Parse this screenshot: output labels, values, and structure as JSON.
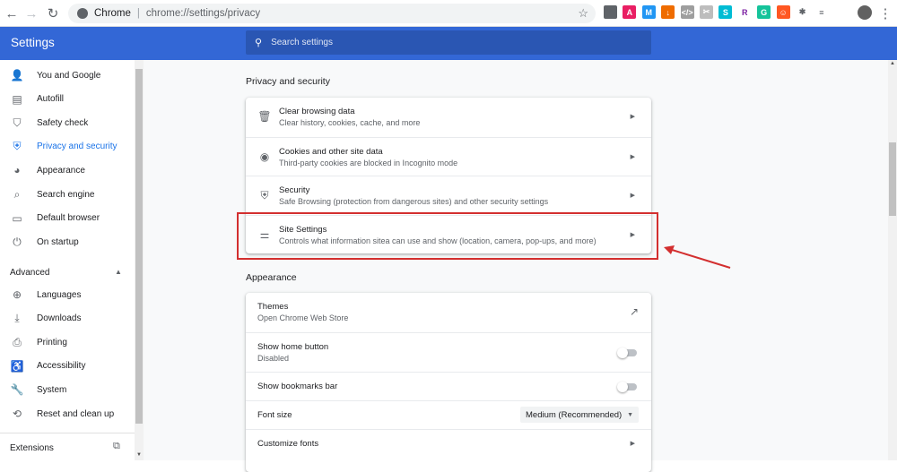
{
  "browser": {
    "back_icon": "←",
    "forward_icon": "→",
    "reload_icon": "↻",
    "chip": "Chrome",
    "url": "chrome://settings/privacy",
    "star_icon": "☆",
    "menu_icon": "⋮"
  },
  "extensions": [
    {
      "name": "eyedropper-icon",
      "glyph": "✎",
      "color": "#5f6368",
      "text": "#5f6368"
    },
    {
      "name": "ext-a-icon",
      "glyph": "A",
      "color": "#e91e63",
      "text": "#fff"
    },
    {
      "name": "ext-m-icon",
      "glyph": "M",
      "color": "#2196f3",
      "text": "#fff"
    },
    {
      "name": "ext-download-icon",
      "glyph": "↓",
      "color": "#ef6c00",
      "text": "#fff"
    },
    {
      "name": "ext-code-icon",
      "glyph": "</>",
      "color": "#9e9e9e",
      "text": "#fff"
    },
    {
      "name": "ext-clip-icon",
      "glyph": "✂",
      "color": "#bdbdbd",
      "text": "#fff"
    },
    {
      "name": "ext-s-icon",
      "glyph": "S",
      "color": "#00bcd4",
      "text": "#fff"
    },
    {
      "name": "ext-r-icon",
      "glyph": "R",
      "color": "#ffffff",
      "text": "#7b1fa2"
    },
    {
      "name": "ext-g-icon",
      "glyph": "G",
      "color": "#15c39a",
      "text": "#fff"
    },
    {
      "name": "ext-avatar-icon",
      "glyph": "☺",
      "color": "#ff5722",
      "text": "#fff"
    },
    {
      "name": "puzzle-icon",
      "glyph": "✱",
      "color": "#ffffff",
      "text": "#5f6368"
    },
    {
      "name": "playlist-icon",
      "glyph": "≡",
      "color": "#ffffff",
      "text": "#5f6368"
    }
  ],
  "header": {
    "title": "Settings",
    "search_placeholder": "Search settings",
    "search_icon": "⚲",
    "color": "#3367d6"
  },
  "sidebar": {
    "items": [
      {
        "label": "You and Google",
        "icon": "👤",
        "icon_name": "person-icon"
      },
      {
        "label": "Autofill",
        "icon": "▤",
        "icon_name": "clipboard-icon"
      },
      {
        "label": "Safety check",
        "icon": "⛉",
        "icon_name": "shield-check-icon"
      },
      {
        "label": "Privacy and security",
        "icon": "⛨",
        "icon_name": "shield-icon",
        "active": true
      },
      {
        "label": "Appearance",
        "icon": "◕",
        "icon_name": "palette-icon"
      },
      {
        "label": "Search engine",
        "icon": "⌕",
        "icon_name": "search-icon"
      },
      {
        "label": "Default browser",
        "icon": "▭",
        "icon_name": "browser-icon"
      },
      {
        "label": "On startup",
        "icon": "⏻",
        "icon_name": "power-icon"
      }
    ],
    "advanced_label": "Advanced",
    "advanced_caret": "▲",
    "advanced_items": [
      {
        "label": "Languages",
        "icon": "⊕",
        "icon_name": "globe-icon"
      },
      {
        "label": "Downloads",
        "icon": "⤓",
        "icon_name": "download-icon"
      },
      {
        "label": "Printing",
        "icon": "⎙",
        "icon_name": "printer-icon"
      },
      {
        "label": "Accessibility",
        "icon": "♿",
        "icon_name": "accessibility-icon"
      },
      {
        "label": "System",
        "icon": "🔧",
        "icon_name": "wrench-icon"
      },
      {
        "label": "Reset and clean up",
        "icon": "⟲",
        "icon_name": "restore-icon"
      }
    ],
    "extensions_label": "Extensions",
    "extensions_icon": "⧉",
    "scroll_down": "▼"
  },
  "privacy": {
    "title": "Privacy and security",
    "rows": [
      {
        "title": "Clear browsing data",
        "subtitle": "Clear history, cookies, cache, and more",
        "icon": "🗑",
        "icon_name": "trash-icon"
      },
      {
        "title": "Cookies and other site data",
        "subtitle": "Third-party cookies are blocked in Incognito mode",
        "icon": "◉",
        "icon_name": "cookie-icon"
      },
      {
        "title": "Security",
        "subtitle": "Safe Browsing (protection from dangerous sites) and other security settings",
        "icon": "⛨",
        "icon_name": "security-shield-icon"
      },
      {
        "title": "Site Settings",
        "subtitle": "Controls what information sitea can use and show (location, camera, pop-ups, and more)",
        "icon": "⚌",
        "icon_name": "tune-icon"
      }
    ],
    "arrow": "▶"
  },
  "appearance": {
    "title": "Appearance",
    "themes_title": "Themes",
    "themes_subtitle": "Open Chrome Web Store",
    "themes_icon": "↗",
    "home_button_title": "Show home button",
    "home_button_subtitle": "Disabled",
    "home_button_on": false,
    "bookmarks_title": "Show bookmarks bar",
    "bookmarks_on": false,
    "font_size_title": "Font size",
    "font_size_value": "Medium (Recommended)",
    "select_caret": "▼",
    "customize_fonts_title": "Customize fonts",
    "arrow": "▶"
  },
  "scrollbar": {
    "up": "▲"
  },
  "annotation": {
    "highlight_color": "#d32f2f"
  }
}
